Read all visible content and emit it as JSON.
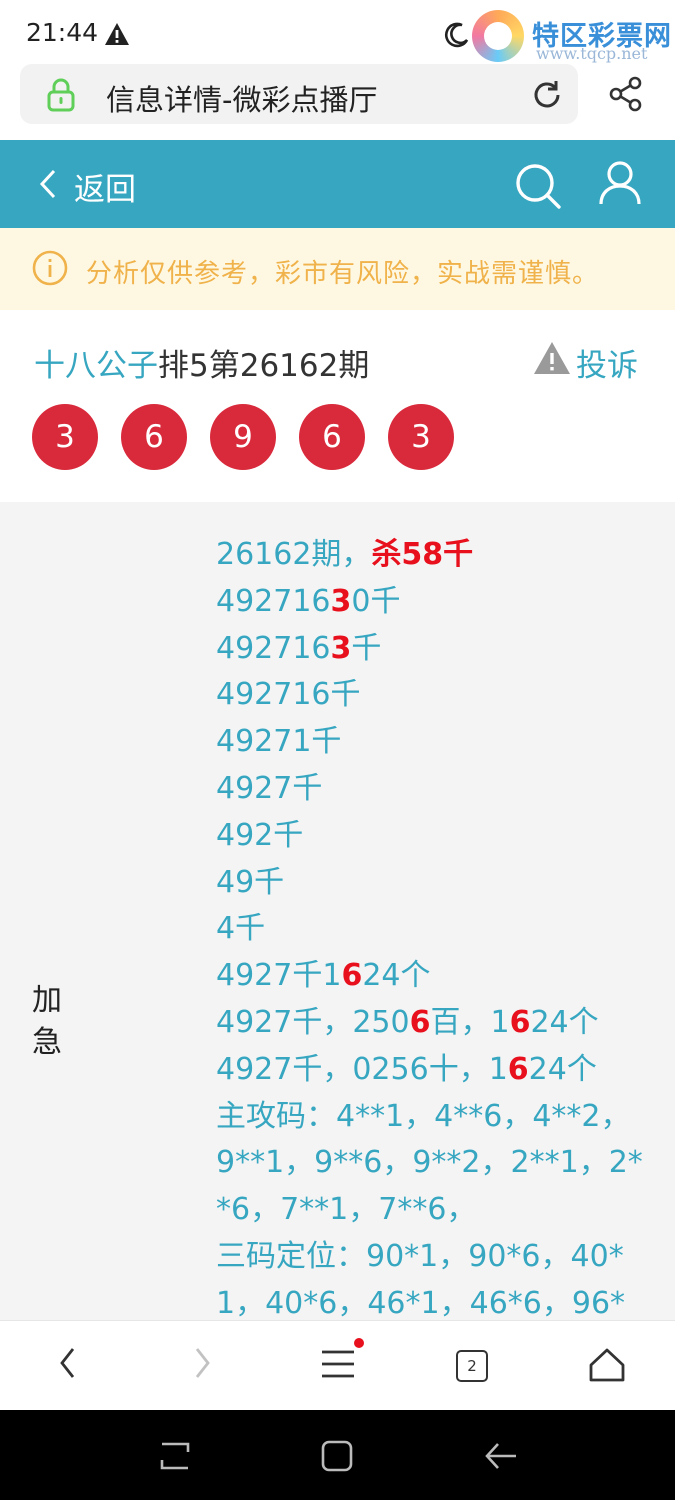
{
  "status_bar": {
    "time": "21:44"
  },
  "watermark": {
    "title": "特区彩票网",
    "url": "www.tqcp.net"
  },
  "browser": {
    "page_title": "信息详情-微彩点播厅"
  },
  "header": {
    "back_label": "返回"
  },
  "notice": {
    "text": "分析仅供参考，彩市有风险，实战需谨慎。"
  },
  "post": {
    "author": "十八公子",
    "title_rest": "排5第26162期",
    "report_label": "投诉",
    "balls": [
      "3",
      "6",
      "9",
      "6",
      "3"
    ]
  },
  "content": {
    "label": "加急",
    "lines": [
      [
        {
          "t": "26162期，"
        },
        {
          "t": "杀58千",
          "hl": true
        }
      ],
      [
        {
          "t": "492716"
        },
        {
          "t": "3",
          "hl": true
        },
        {
          "t": "0千"
        }
      ],
      [
        {
          "t": "492716"
        },
        {
          "t": "3",
          "hl": true
        },
        {
          "t": "千"
        }
      ],
      [
        {
          "t": "492716千"
        }
      ],
      [
        {
          "t": "49271千"
        }
      ],
      [
        {
          "t": "4927千"
        }
      ],
      [
        {
          "t": "492千"
        }
      ],
      [
        {
          "t": "49千"
        }
      ],
      [
        {
          "t": "4千"
        }
      ],
      [
        {
          "t": "4927千1"
        },
        {
          "t": "6",
          "hl": true
        },
        {
          "t": "24个"
        }
      ],
      [
        {
          "t": "4927千，250"
        },
        {
          "t": "6",
          "hl": true
        },
        {
          "t": "百，1"
        },
        {
          "t": "6",
          "hl": true
        },
        {
          "t": "24个"
        }
      ],
      [
        {
          "t": "4927千，0256十，1"
        },
        {
          "t": "6",
          "hl": true
        },
        {
          "t": "24个"
        }
      ],
      [
        {
          "t": "主攻码：4**1，4**6，4**2，"
        }
      ],
      [
        {
          "t": "9**1，9**6，9**2，2**1，2*"
        }
      ],
      [
        {
          "t": "*6，7**1，7**6，"
        }
      ],
      [
        {
          "t": "三码定位：90*1，90*6，40*"
        }
      ],
      [
        {
          "t": "1，40*6，46*1，46*6，96*"
        }
      ]
    ]
  },
  "bottom_nav": {
    "tabs_count": "2"
  },
  "colors": {
    "accent": "#36a6c1",
    "ball": "#d92a3c",
    "highlight": "#e8101c",
    "notice_text": "#f0b24a"
  }
}
